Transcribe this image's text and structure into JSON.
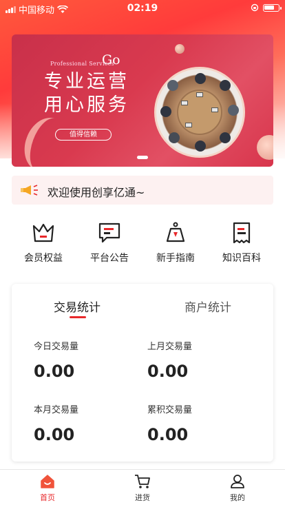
{
  "status_bar": {
    "carrier": "中国移动",
    "time": "02:19",
    "battery_level": 0.8
  },
  "banner": {
    "subtitle": "Professional Services",
    "go": "Go",
    "title_line1": "专业运营",
    "title_line2": "用心服务",
    "button": "值得信赖",
    "accent": "#d93a4f"
  },
  "notice": {
    "text": "欢迎使用创享亿通~"
  },
  "menu": {
    "items": [
      {
        "label": "会员权益",
        "icon": "crown-icon"
      },
      {
        "label": "平台公告",
        "icon": "message-icon"
      },
      {
        "label": "新手指南",
        "icon": "guide-icon"
      },
      {
        "label": "知识百科",
        "icon": "receipt-icon"
      }
    ]
  },
  "stats": {
    "tabs": [
      {
        "label": "交易统计",
        "active": true
      },
      {
        "label": "商户统计",
        "active": false
      }
    ],
    "items": [
      {
        "label": "今日交易量",
        "value": "0.00"
      },
      {
        "label": "上月交易量",
        "value": "0.00"
      },
      {
        "label": "本月交易量",
        "value": "0.00"
      },
      {
        "label": "累积交易量",
        "value": "0.00"
      }
    ]
  },
  "tabbar": {
    "items": [
      {
        "label": "首页",
        "icon": "home-icon",
        "active": true
      },
      {
        "label": "进货",
        "icon": "cart-icon",
        "active": false
      },
      {
        "label": "我的",
        "icon": "user-icon",
        "active": false
      }
    ],
    "accent": "#e8282b"
  }
}
